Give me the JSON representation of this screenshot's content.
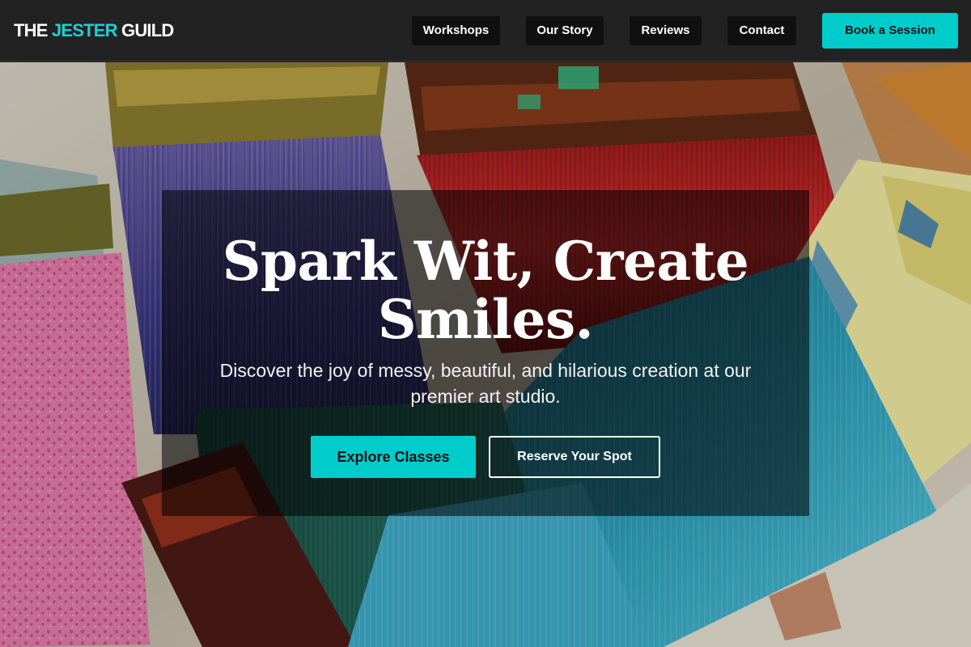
{
  "header": {
    "logo": {
      "part1": "THE ",
      "part2": "JESTER",
      "part3": " GUILD"
    },
    "nav": [
      {
        "label": "Workshops"
      },
      {
        "label": "Our Story"
      },
      {
        "label": "Reviews"
      },
      {
        "label": "Contact"
      }
    ],
    "cta_label": "Book a Session"
  },
  "hero": {
    "title": "Spark Wit, Create Smiles.",
    "subtitle": "Discover the joy of messy, beautiful, and hilarious creation at our premier art studio.",
    "primary_button": "Explore Classes",
    "secondary_button": "Reserve Your Spot",
    "background_image": "paint-brushes-photo"
  },
  "colors": {
    "accent": "#00cccc",
    "nav_background": "#222222",
    "nav_link_background": "#101010",
    "overlay": "rgba(0,0,0,0.55)"
  }
}
